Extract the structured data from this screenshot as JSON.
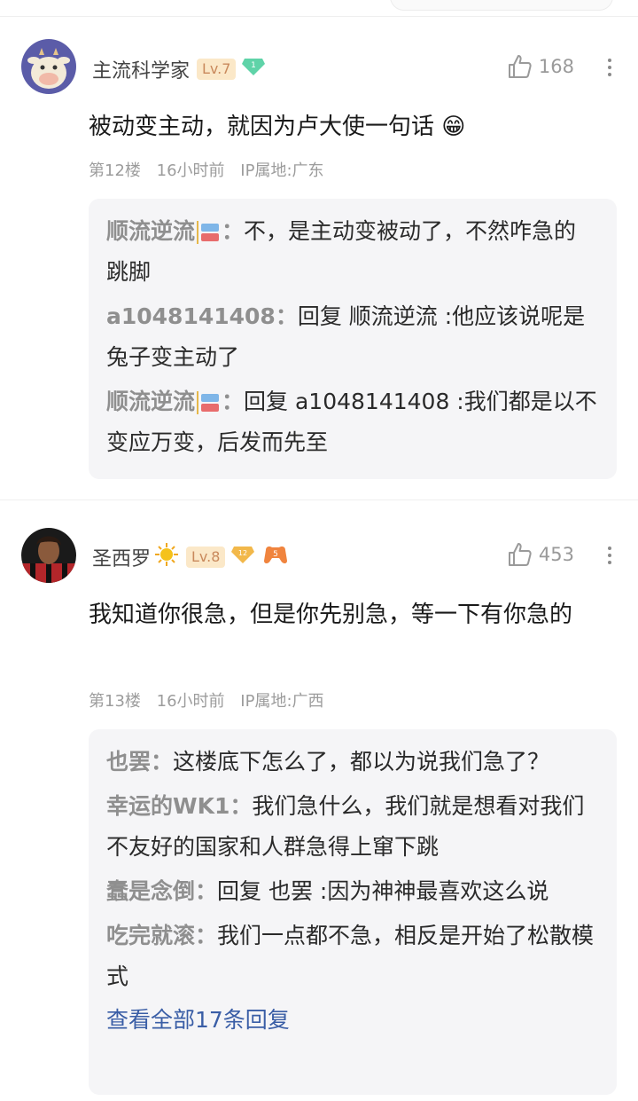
{
  "posts": [
    {
      "username": "主流科学家",
      "level": "Lv.7",
      "gem_level": "1",
      "likes": "168",
      "content": "被动变主动，就因为卢大使一句话",
      "emoji": "😁",
      "floor": "第12楼",
      "time": "16小时前",
      "ip": "IP属地:广东",
      "replies": [
        {
          "name": "顺流逆流",
          "has_badge": true,
          "sep": "：",
          "text": "不，是主动变被动了，不然咋急的跳脚"
        },
        {
          "name": "a1048141408",
          "has_badge": false,
          "sep": "：",
          "text": "回复 顺流逆流 :他应该说呢是兔子变主动了"
        },
        {
          "name": "顺流逆流",
          "has_badge": true,
          "sep": "：",
          "text": "回复 a1048141408 :我们都是以不变应万变，后发而先至"
        }
      ]
    },
    {
      "username": "圣西罗",
      "level": "Lv.8",
      "gem_level": "12",
      "extra_badge": "5",
      "likes": "453",
      "content": "我知道你很急，但是你先别急，等一下有你急的",
      "floor": "第13楼",
      "time": "16小时前",
      "ip": "IP属地:广西",
      "replies": [
        {
          "name": "也罢",
          "sep": "：",
          "text": "这楼底下怎么了，都以为说我们急了？"
        },
        {
          "name": "幸运的WK1",
          "sep": "：",
          "text": "我们急什么，我们就是想看对我们不友好的国家和人群急得上窜下跳"
        },
        {
          "name": "蠢是念倒",
          "sep": "：",
          "text": "回复 也罢 :因为神神最喜欢这么说"
        },
        {
          "name": "吃完就滚",
          "sep": "：",
          "text": "我们一点都不急，相反是开始了松散模式"
        }
      ],
      "view_all": "查看全部17条回复"
    }
  ],
  "colors": {
    "level_bg": "#fbe8c8",
    "level_text": "#c9895c",
    "link": "#3a5ea6",
    "reply_bg": "#f5f5f7"
  },
  "icons": {
    "like": "thumb-up-icon",
    "more": "more-vertical-icon",
    "gem": "gem-icon"
  }
}
